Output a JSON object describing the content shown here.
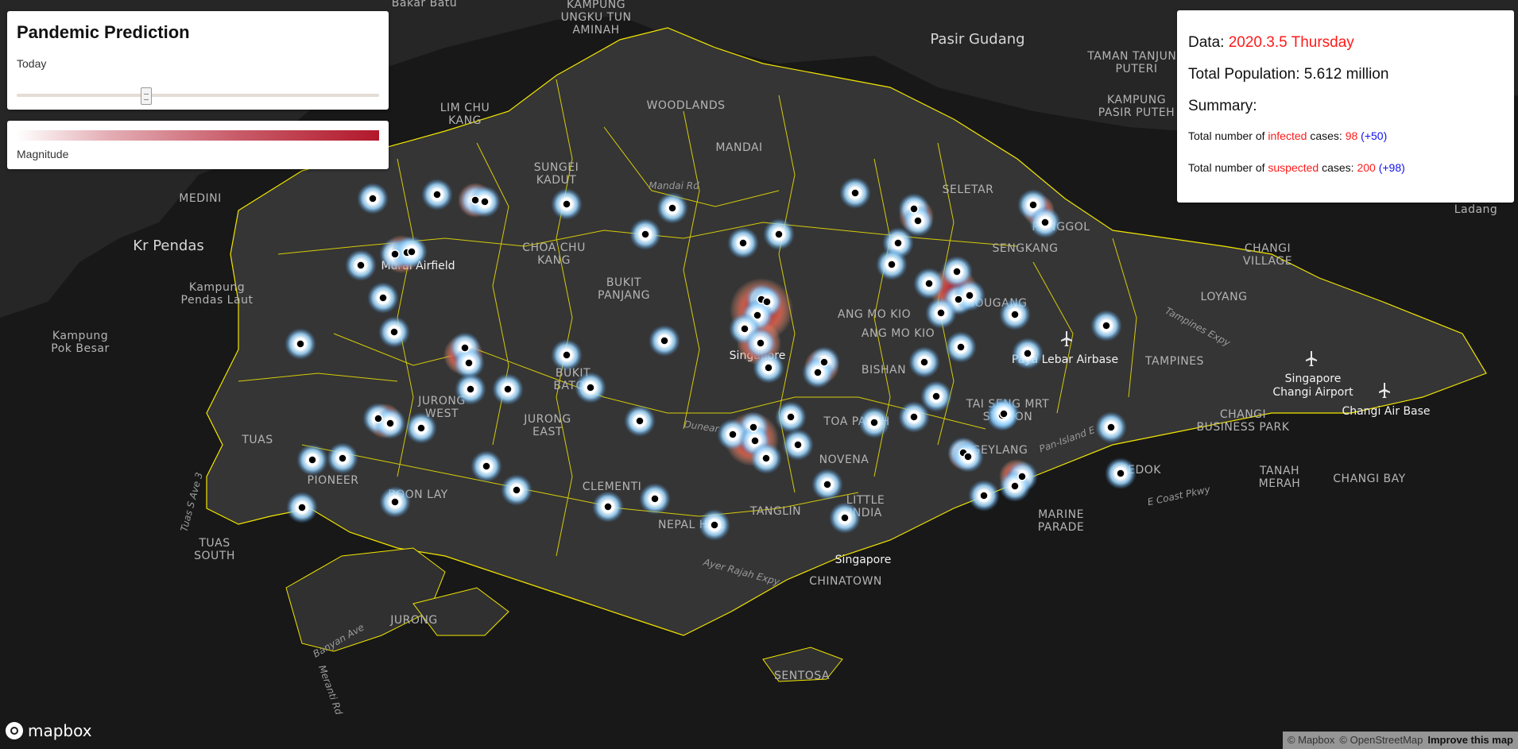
{
  "controls": {
    "title": "Pandemic Prediction",
    "slider_label": "Today",
    "legend_label": "Magnitude",
    "colors": {
      "heat": "#b2182b",
      "glow": "#9ed8ff",
      "boundary": "#f2e600"
    }
  },
  "info": {
    "date_label": "Data: ",
    "date_value": "2020.3.5 Thursday",
    "population_label": "Total Population: 5.612 million",
    "summary_label": "Summary:",
    "infected_prefix": "Total number of ",
    "infected_word": "infected",
    "infected_suffix": " cases: ",
    "infected_value": "98",
    "infected_delta": "(+50)",
    "suspected_prefix": "Total number of ",
    "suspected_word": "suspected",
    "suspected_suffix": " cases: ",
    "suspected_value": "200",
    "suspected_delta": "(+98)"
  },
  "map_labels": {
    "bakar_batu": "Bakar Batu",
    "ulu_tiram_1": "KAMPUNG",
    "ulu_tiram_2": "UNGKU TUN",
    "ulu_tiram_3": "AMINAH",
    "pasir_gudang": "Pasir Gudang",
    "taman_tanjung_1": "TAMAN TANJUNG",
    "taman_tanjung_2": "PUTERI",
    "kampung_pasir_1": "KAMPUNG",
    "kampung_pasir_2": "PASIR PUTEH",
    "lim_chu_kang_1": "LIM CHU",
    "lim_chu_kang_2": "KANG",
    "woodlands": "WOODLANDS",
    "mandai": "MANDAI",
    "sungei_kadut_1": "SUNGEI",
    "sungei_kadut_2": "KADUT",
    "mandai_rd": "Mandai Rd",
    "seletar": "SELETAR",
    "punggol": "PUNGGOL",
    "sengkang": "SENGKANG",
    "medini": "MEDINI",
    "kr_pendas": "Kr Pendas",
    "kampung_pendas_1": "Kampung",
    "kampung_pendas_2": "Pendas Laut",
    "kampung_pok_1": "Kampung",
    "kampung_pok_2": "Pok Besar",
    "murai_airfield": "Murai Airfield",
    "choa_chu_kang_1": "CHOA CHU",
    "choa_chu_kang_2": "KANG",
    "bukit_panjang_1": "BUKIT",
    "bukit_panjang_2": "PANJANG",
    "ang_mo_kio_1": "ANG MO KIO",
    "ang_mo_kio_2": "ANG MO KIO",
    "hougang": "HOUGANG",
    "changi_village_1": "CHANGI",
    "changi_village_2": "VILLAGE",
    "loyang": "LOYANG",
    "tampines_expy": "Tampines Expy",
    "singapore_center": "Singapore",
    "bishan": "BISHAN",
    "paya_lebar": "Paya Lebar Airbase",
    "tampines": "TAMPINES",
    "changi_airport_1": "Singapore",
    "changi_airport_2": "Changi Airport",
    "changi_air_base": "Changi Air Base",
    "bukit_batok_1": "BUKIT",
    "bukit_batok_2": "BATOK",
    "jurong_west_1": "JURONG",
    "jurong_west_2": "WEST",
    "jurong_east_1": "JURONG",
    "jurong_east_2": "EAST",
    "tuas": "TUAS",
    "toa_payoh": "TOA PAYOH",
    "tai_seng_1": "TAI SENG MRT",
    "tai_seng_2": "STATION",
    "changi_bp_1": "CHANGI",
    "changi_bp_2": "BUSINESS PARK",
    "dunear": "Dunear",
    "pan_island": "Pan-Island E",
    "pioneer": "PIONEER",
    "novena": "NOVENA",
    "tanah_merah_1": "TANAH",
    "tanah_merah_2": "MERAH",
    "changi_bay": "CHANGI BAY",
    "clementi": "CLEMENTI",
    "geylang": "GEYLANG",
    "bedok": "BEDOK",
    "boon_lay": "BOON LAY",
    "tanglin": "TANGLIN",
    "little_india_1": "LITTLE",
    "little_india_2": "INDIA",
    "e_coast_pkwy": "E Coast Pkwy",
    "tuas_s_ave": "Tuas S Ave 3",
    "nepal_hill": "NEPAL HILL",
    "marine_parade_1": "MARINE",
    "marine_parade_2": "PARADE",
    "tuas_south_1": "TUAS",
    "tuas_south_2": "SOUTH",
    "singapore_south": "Singapore",
    "ayer_rajah": "Ayer Rajah Expy",
    "chinatown": "CHINATOWN",
    "jurong": "JURONG",
    "banyan_ave": "Banyan Ave",
    "meranti_rd": "Meranti Rd",
    "sentosa": "SENTOSA",
    "ladang": "Ladang"
  },
  "footer": {
    "logo_text": "mapbox",
    "attrib_mapbox": "© Mapbox",
    "attrib_osm": "© OpenStreetMap",
    "improve": "Improve this map"
  }
}
